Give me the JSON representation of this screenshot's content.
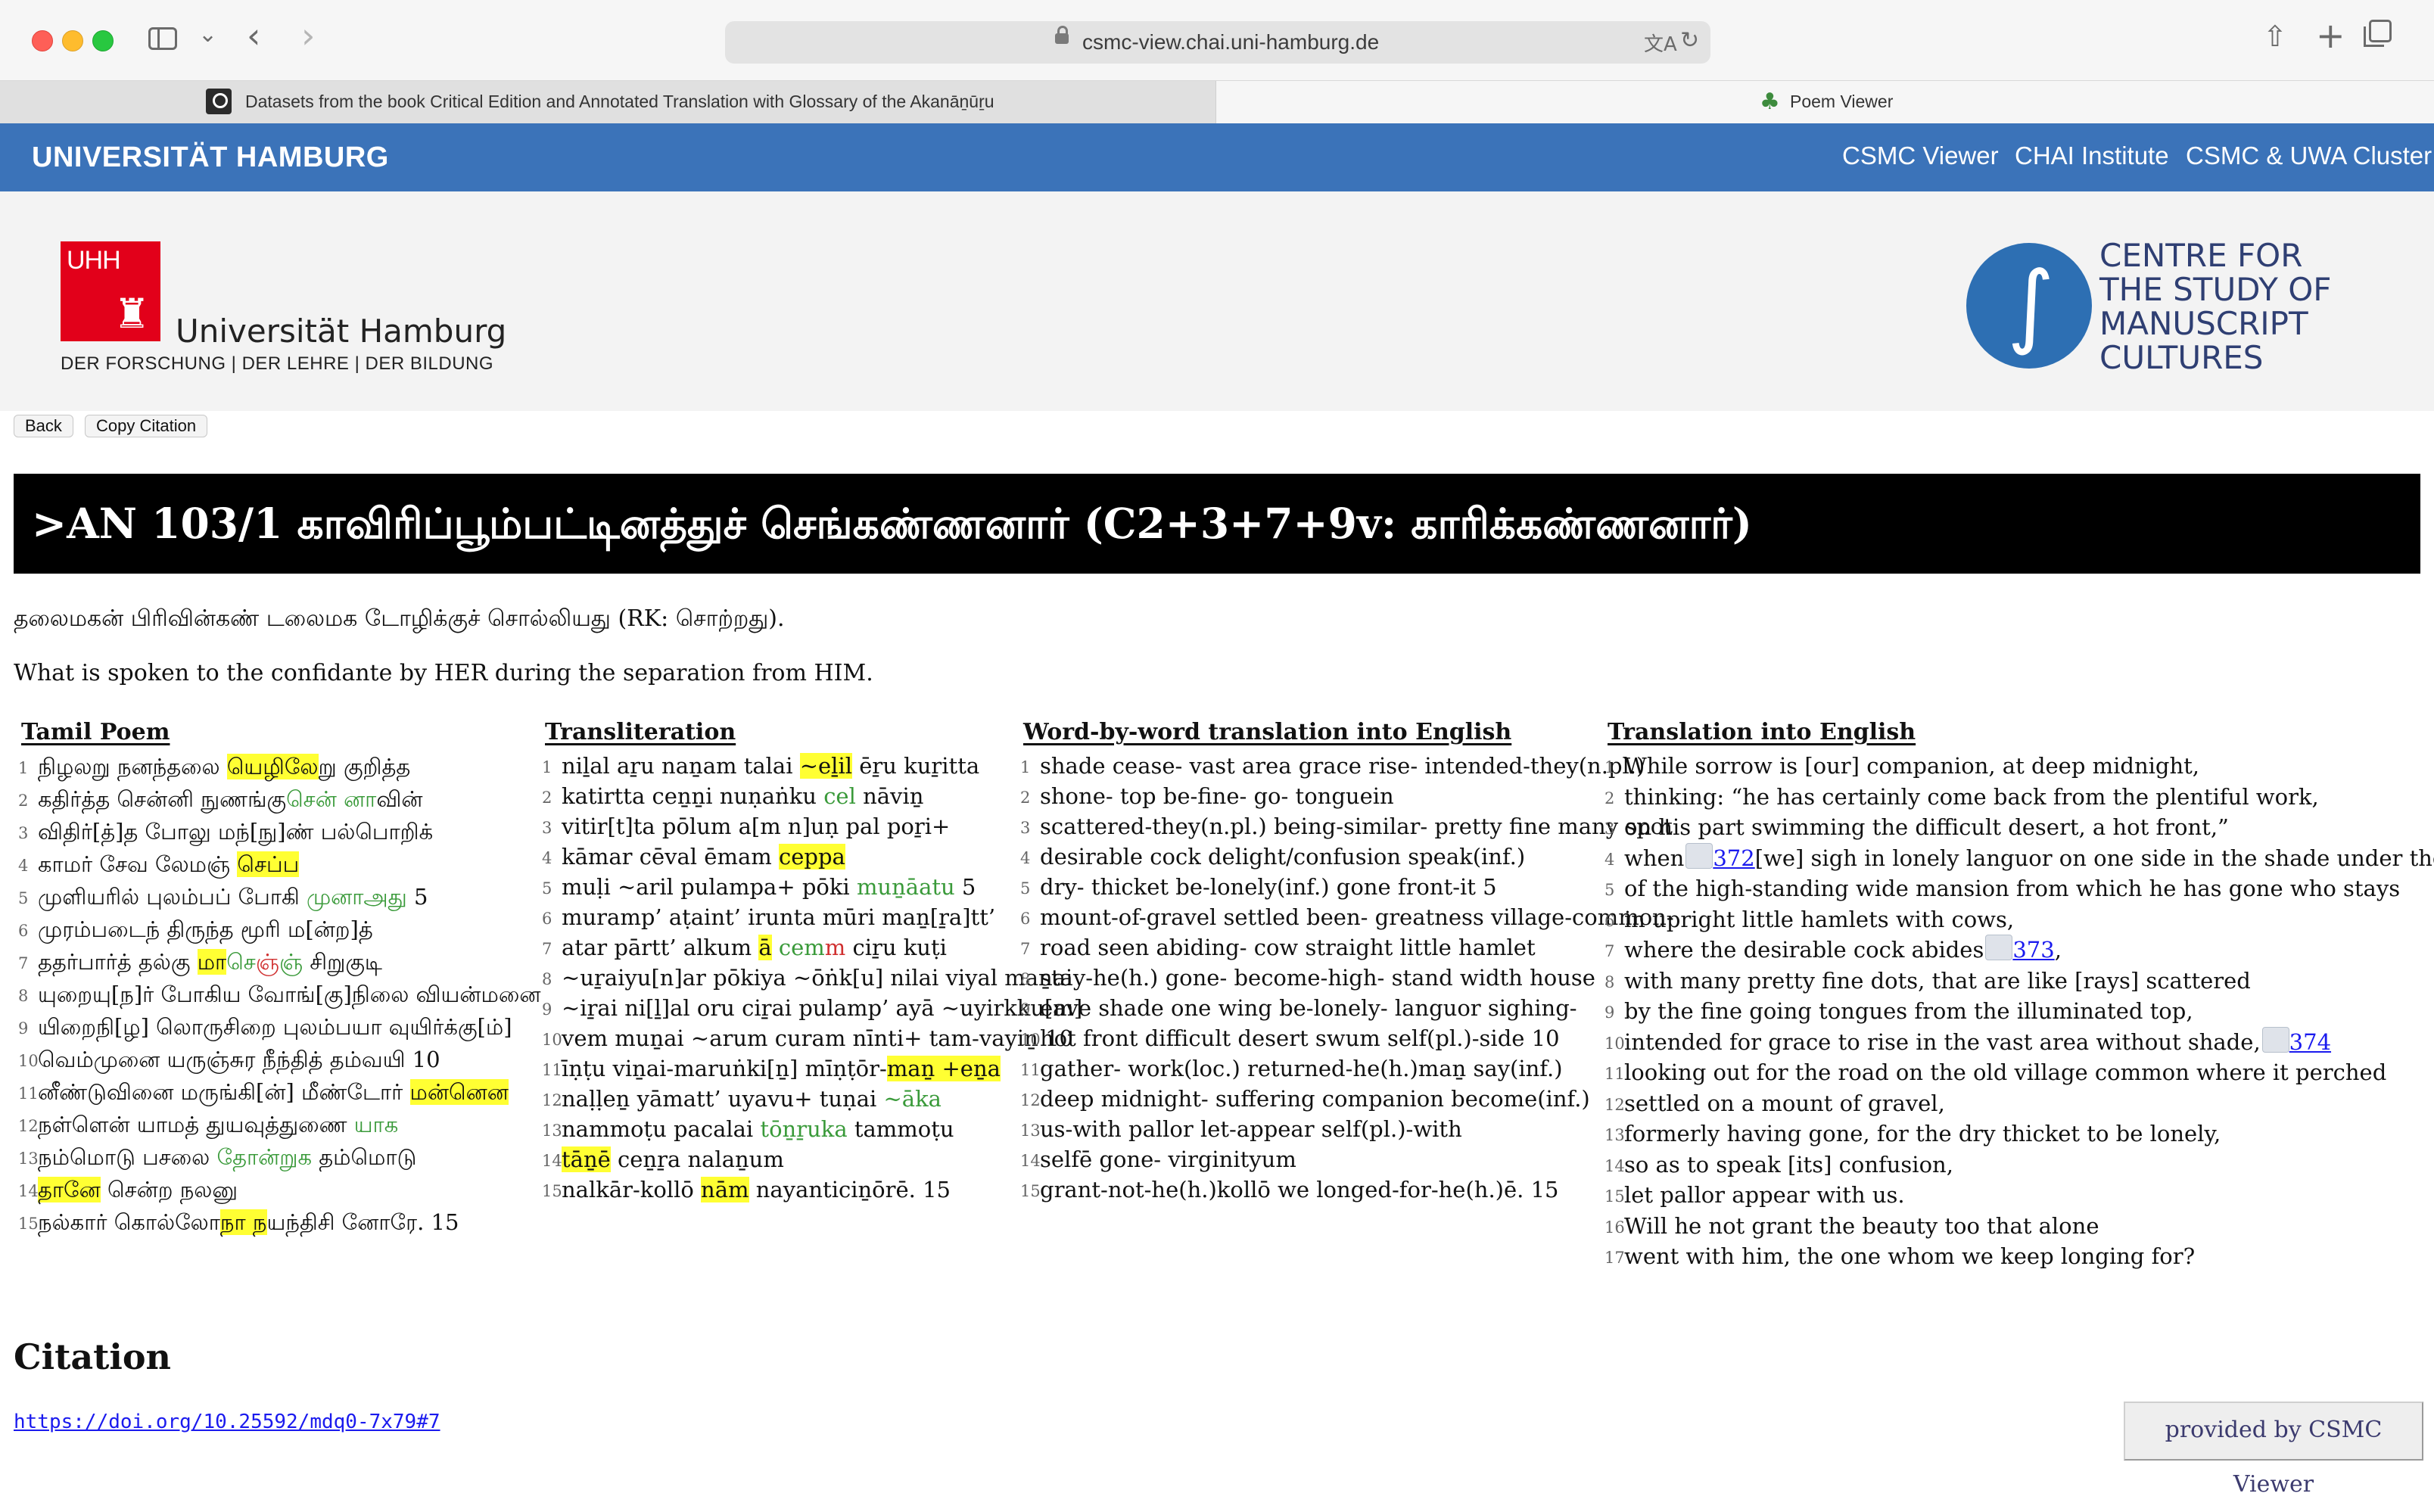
{
  "browser": {
    "url": "csmc-view.chai.uni-hamburg.de",
    "tabs": [
      {
        "label": "Datasets from the book Critical Edition and Annotated Translation with Glossary of the Akanāṉūṟu",
        "icon": "search-icon"
      },
      {
        "label": "Poem Viewer",
        "icon": "palm-tree-icon"
      }
    ]
  },
  "header": {
    "brand": "UNIVERSITÄT HAMBURG",
    "nav": [
      "CSMC Viewer",
      "CHAI Institute",
      "CSMC & UWA Cluster"
    ],
    "uhh_logo_text": "UHH",
    "uhh_name": "Universität Hamburg",
    "uhh_claim": "DER FORSCHUNG | DER LEHRE | DER BILDUNG",
    "csmc_name": "CENTRE FOR THE STUDY OF MANUSCRIPT CULTURES"
  },
  "buttons": {
    "back": "Back",
    "copy_citation": "Copy Citation"
  },
  "title": ">AN 103/1 காவிரிப்பூம்பட்டினத்துச் செங்கண்ணனார் (C2+3+7+9v: காரிக்கண்ணனார்)",
  "intro": {
    "tamil": "தலைமகன் பிரிவின்கண் டலைமக டோழிக்குச் சொல்லியது (RK: சொற்றது).",
    "english": "What is spoken to the confidante by HER during the separation from HIM."
  },
  "columns": {
    "tamil": {
      "heading": "Tamil Poem",
      "lines": [
        {
          "n": "1",
          "parts": [
            {
              "t": "நிழலறு நனந்தலை "
            },
            {
              "t": "யெழிலே",
              "c": "hl"
            },
            {
              "t": "று குறித்த"
            }
          ]
        },
        {
          "n": "2",
          "parts": [
            {
              "t": "கதிர்த்த சென்னி நுணங்கு"
            },
            {
              "t": "சென் னா",
              "c": "grn"
            },
            {
              "t": "வின்"
            }
          ]
        },
        {
          "n": "3",
          "parts": [
            {
              "t": "விதிர்[த்]த போலு மந்[நு]ண் பல்பொறிக்"
            }
          ]
        },
        {
          "n": "4",
          "parts": [
            {
              "t": "காமர் சேவ லேமஞ் "
            },
            {
              "t": "செப்ப",
              "c": "hl"
            }
          ]
        },
        {
          "n": "5",
          "parts": [
            {
              "t": "முளியரில் புலம்பப் போகி "
            },
            {
              "t": "முனாஅது",
              "c": "grn"
            },
            {
              "t": " 5"
            }
          ]
        },
        {
          "n": "6",
          "parts": [
            {
              "t": "முரம்படைந் திருந்த மூரி ம[ன்ற]த்"
            }
          ]
        },
        {
          "n": "7",
          "parts": [
            {
              "t": "ததர்பார்த் தல்கு "
            },
            {
              "t": "மா",
              "c": "hl"
            },
            {
              "t": "செ",
              "c": "grn"
            },
            {
              "t": "ஞ்",
              "c": "red"
            },
            {
              "t": "ஞ்",
              "c": "grn"
            },
            {
              "t": " சிறுகுடி"
            }
          ]
        },
        {
          "n": "8",
          "parts": [
            {
              "t": "யுறையு[ந]ர் போகிய வோங்[கு]நிலை வியன்மனை"
            }
          ]
        },
        {
          "n": "9",
          "parts": [
            {
              "t": "யிறைநி[ழ] லொருசிறை புலம்பயா வுயிர்க்கு[ம்]"
            }
          ]
        },
        {
          "n": "10",
          "parts": [
            {
              "t": "வெம்முனை யருஞ்சுர நீந்தித் தம்வயி 10"
            }
          ]
        },
        {
          "n": "11",
          "parts": [
            {
              "t": "னீண்டுவினை மருங்கி[ன்] மீண்டோர் "
            },
            {
              "t": "மன்னென",
              "c": "hl"
            }
          ]
        },
        {
          "n": "12",
          "parts": [
            {
              "t": "நள்ளென் யாமத் துயவுத்துணை "
            },
            {
              "t": "யாக",
              "c": "grn"
            }
          ]
        },
        {
          "n": "13",
          "parts": [
            {
              "t": "நம்மொடு பசலை "
            },
            {
              "t": "தோன்றுக",
              "c": "grn"
            },
            {
              "t": " தம்மொடு"
            }
          ]
        },
        {
          "n": "14",
          "parts": [
            {
              "t": "தானே",
              "c": "hl"
            },
            {
              "t": " சென்ற நலனு"
            }
          ]
        },
        {
          "n": "15",
          "parts": [
            {
              "t": "நல்கார் கொல்லோ"
            },
            {
              "t": "நா ந",
              "c": "hl"
            },
            {
              "t": "யந்திசி னோரே. 15"
            }
          ]
        }
      ]
    },
    "translit": {
      "heading": "Transliteration",
      "lines": [
        {
          "n": "1",
          "parts": [
            {
              "t": "niḻal aṟu naṉam talai "
            },
            {
              "t": "~eḻil",
              "c": "hl"
            },
            {
              "t": " ēṟu kuṟitta"
            }
          ]
        },
        {
          "n": "2",
          "parts": [
            {
              "t": "katirtta ceṉṉi nuṇaṅku "
            },
            {
              "t": "cel",
              "c": "grn"
            },
            {
              "t": " nāviṉ"
            }
          ]
        },
        {
          "n": "3",
          "parts": [
            {
              "t": "vitir[t]ta pōlum a[m n]uṇ pal poṟi+"
            }
          ]
        },
        {
          "n": "4",
          "parts": [
            {
              "t": "kāmar cēval ēmam "
            },
            {
              "t": "ceppa",
              "c": "hl"
            }
          ]
        },
        {
          "n": "5",
          "parts": [
            {
              "t": "muḷi ~aril pulampa+ pōki "
            },
            {
              "t": "muṉāatu",
              "c": "grn"
            },
            {
              "t": " 5"
            }
          ]
        },
        {
          "n": "6",
          "parts": [
            {
              "t": "muramp’ aṭaint’ irunta mūri maṉ[ṟa]tt’"
            }
          ]
        },
        {
          "n": "7",
          "parts": [
            {
              "t": "atar pārtt’ alkum "
            },
            {
              "t": "ā",
              "c": "hl"
            },
            {
              "t": " "
            },
            {
              "t": "cem",
              "c": "grn"
            },
            {
              "t": "m",
              "c": "red"
            },
            {
              "t": " ciṟu kuṭi"
            }
          ]
        },
        {
          "n": "8",
          "parts": [
            {
              "t": "~uṟaiyu[n]ar pōkiya ~ōṅk[u] nilai viyal maṉai"
            }
          ]
        },
        {
          "n": "9",
          "parts": [
            {
              "t": "~iṟai ni[ḻ]al oru ciṟai pulamp’ ayā ~uyirkku[m]"
            }
          ]
        },
        {
          "n": "10",
          "parts": [
            {
              "t": "vem muṉai ~arum curam nīnti+ tam-vayiṉ 10"
            }
          ]
        },
        {
          "n": "11",
          "parts": [
            {
              "t": "īṇṭu viṉai-maruṅki[ṉ] mīṇṭōr-"
            },
            {
              "t": "maṉ +eṉa",
              "c": "hl"
            }
          ]
        },
        {
          "n": "12",
          "parts": [
            {
              "t": "naḷḷeṉ yāmatt’ uyavu+ tuṇai "
            },
            {
              "t": "~āka",
              "c": "grn"
            }
          ]
        },
        {
          "n": "13",
          "parts": [
            {
              "t": "nammoṭu pacalai "
            },
            {
              "t": "tōṉṟuka",
              "c": "grn"
            },
            {
              "t": " tammoṭu"
            }
          ]
        },
        {
          "n": "14",
          "parts": [
            {
              "t": "tāṉē",
              "c": "hl"
            },
            {
              "t": " ceṉṟa nalaṉum"
            }
          ]
        },
        {
          "n": "15",
          "parts": [
            {
              "t": "nalkār-kollō "
            },
            {
              "t": "nām",
              "c": "hl"
            },
            {
              "t": " nayanticiṉōrē. 15"
            }
          ]
        }
      ]
    },
    "wbw": {
      "heading": "Word-by-word translation into English",
      "lines": [
        {
          "n": "1",
          "parts": [
            {
              "t": "shade cease- vast area grace rise- intended-they(n.pl.)"
            }
          ]
        },
        {
          "n": "2",
          "parts": [
            {
              "t": "shone- top be-fine- go- tonguein"
            }
          ]
        },
        {
          "n": "3",
          "parts": [
            {
              "t": "scattered-they(n.pl.) being-similar- pretty fine many spot"
            }
          ]
        },
        {
          "n": "4",
          "parts": [
            {
              "t": "desirable cock delight/confusion speak(inf.)"
            }
          ]
        },
        {
          "n": "5",
          "parts": [
            {
              "t": "dry- thicket be-lonely(inf.) gone front-it 5"
            }
          ]
        },
        {
          "n": "6",
          "parts": [
            {
              "t": "mount-of-gravel settled been- greatness village-common-"
            }
          ]
        },
        {
          "n": "7",
          "parts": [
            {
              "t": "road seen abiding- cow straight little hamlet"
            }
          ]
        },
        {
          "n": "8",
          "parts": [
            {
              "t": "stay-he(h.) gone- become-high- stand width house"
            }
          ]
        },
        {
          "n": "9",
          "parts": [
            {
              "t": "eave shade one wing be-lonely- languor sighing-"
            }
          ]
        },
        {
          "n": "10",
          "parts": [
            {
              "t": "hot front difficult desert swum self(pl.)-side 10"
            }
          ]
        },
        {
          "n": "11",
          "parts": [
            {
              "t": "gather- work(loc.) returned-he(h.)maṉ say(inf.)"
            }
          ]
        },
        {
          "n": "12",
          "parts": [
            {
              "t": "deep midnight- suffering companion become(inf.)"
            }
          ]
        },
        {
          "n": "13",
          "parts": [
            {
              "t": "us-with pallor let-appear self(pl.)-with"
            }
          ]
        },
        {
          "n": "14",
          "parts": [
            {
              "t": "selfē gone- virginityum"
            }
          ]
        },
        {
          "n": "15",
          "parts": [
            {
              "t": "grant-not-he(h.)kollō we longed-for-he(h.)ē. 15"
            }
          ]
        }
      ]
    },
    "english": {
      "heading": "Translation into English",
      "lines": [
        {
          "n": "1",
          "parts": [
            {
              "t": "While sorrow is [our] companion, at deep midnight,"
            }
          ]
        },
        {
          "n": "2",
          "parts": [
            {
              "t": "thinking: “he has certainly come back from the plentiful work,"
            }
          ]
        },
        {
          "n": "3",
          "parts": [
            {
              "t": "on his part swimming the difficult desert, a hot front,”"
            }
          ]
        },
        {
          "n": "4",
          "parts": [
            {
              "t": "when"
            },
            {
              "t": "",
              "c": "fn"
            },
            {
              "t": "372",
              "c": "link"
            },
            {
              "t": "[we] sigh in lonely languor on one side in the shade under the eave"
            }
          ]
        },
        {
          "n": "5",
          "parts": [
            {
              "t": "of the high-standing wide mansion from which he has gone who stays"
            }
          ]
        },
        {
          "n": "6",
          "parts": [
            {
              "t": "in upright little hamlets with cows,"
            }
          ]
        },
        {
          "n": "7",
          "parts": [
            {
              "t": "where the desirable cock abides"
            },
            {
              "t": "",
              "c": "fn"
            },
            {
              "t": "373",
              "c": "link"
            },
            {
              "t": ","
            }
          ]
        },
        {
          "n": "8",
          "parts": [
            {
              "t": "with many pretty fine dots, that are like [rays] scattered"
            }
          ]
        },
        {
          "n": "9",
          "parts": [
            {
              "t": "by the fine going tongues from the illuminated top,"
            }
          ]
        },
        {
          "n": "10",
          "parts": [
            {
              "t": "intended for grace to rise in the vast area without shade,"
            },
            {
              "t": "",
              "c": "fn"
            },
            {
              "t": "374",
              "c": "link"
            }
          ]
        },
        {
          "n": "11",
          "parts": [
            {
              "t": "looking out for the road on the old village common where it perched"
            }
          ]
        },
        {
          "n": "12",
          "parts": [
            {
              "t": "settled on a mount of gravel,"
            }
          ]
        },
        {
          "n": "13",
          "parts": [
            {
              "t": "formerly having gone, for the dry thicket to be lonely,"
            }
          ]
        },
        {
          "n": "14",
          "parts": [
            {
              "t": "so as to speak [its] confusion,"
            }
          ]
        },
        {
          "n": "15",
          "parts": [
            {
              "t": "let pallor appear with us."
            }
          ]
        },
        {
          "n": "16",
          "parts": [
            {
              "t": "Will he not grant the beauty too that alone"
            }
          ]
        },
        {
          "n": "17",
          "parts": [
            {
              "t": "went with him, the one whom we keep longing for?"
            }
          ]
        }
      ]
    }
  },
  "citation": {
    "heading": "Citation",
    "doi": "https://doi.org/10.25592/mdq0-7x79#7"
  },
  "footer": {
    "provided": "provided by CSMC Viewer"
  }
}
